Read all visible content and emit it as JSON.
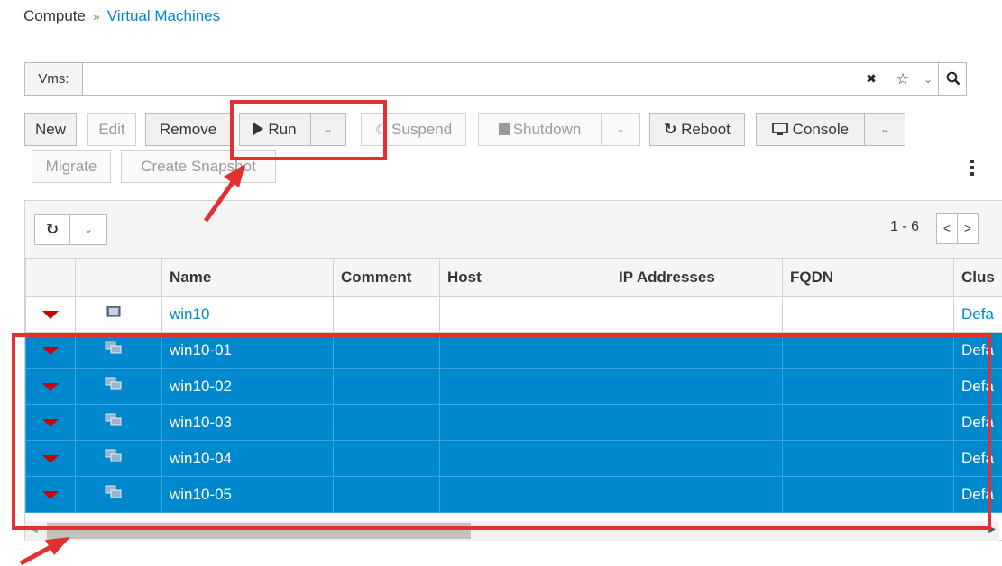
{
  "breadcrumb": {
    "parent": "Compute",
    "separator": "»",
    "current": "Virtual Machines"
  },
  "search": {
    "label": "Vms:",
    "value": "",
    "clear_glyph": "✖",
    "bookmark_glyph": "☆",
    "caret_glyph": "⌄",
    "search_glyph": "🔍"
  },
  "toolbar": {
    "new": "New",
    "edit": "Edit",
    "remove": "Remove",
    "run": "Run",
    "suspend": "Suspend",
    "shutdown": "Shutdown",
    "reboot": "Reboot",
    "console": "Console",
    "migrate": "Migrate",
    "create_snapshot": "Create Snapshot"
  },
  "grid": {
    "pager": "1 - 6",
    "columns": [
      "",
      "",
      "Name",
      "Comment",
      "Host",
      "IP Addresses",
      "FQDN",
      "Clus"
    ],
    "rows": [
      {
        "name": "win10",
        "cluster": "Defa",
        "selected": false
      },
      {
        "name": "win10-01",
        "cluster": "Defa",
        "selected": true
      },
      {
        "name": "win10-02",
        "cluster": "Defa",
        "selected": true
      },
      {
        "name": "win10-03",
        "cluster": "Defa",
        "selected": true
      },
      {
        "name": "win10-04",
        "cluster": "Defa",
        "selected": true
      },
      {
        "name": "win10-05",
        "cluster": "Defa",
        "selected": true
      }
    ]
  },
  "colors": {
    "accent": "#0088ce",
    "status_down": "#cc0000",
    "annotation": "#e0302f"
  }
}
